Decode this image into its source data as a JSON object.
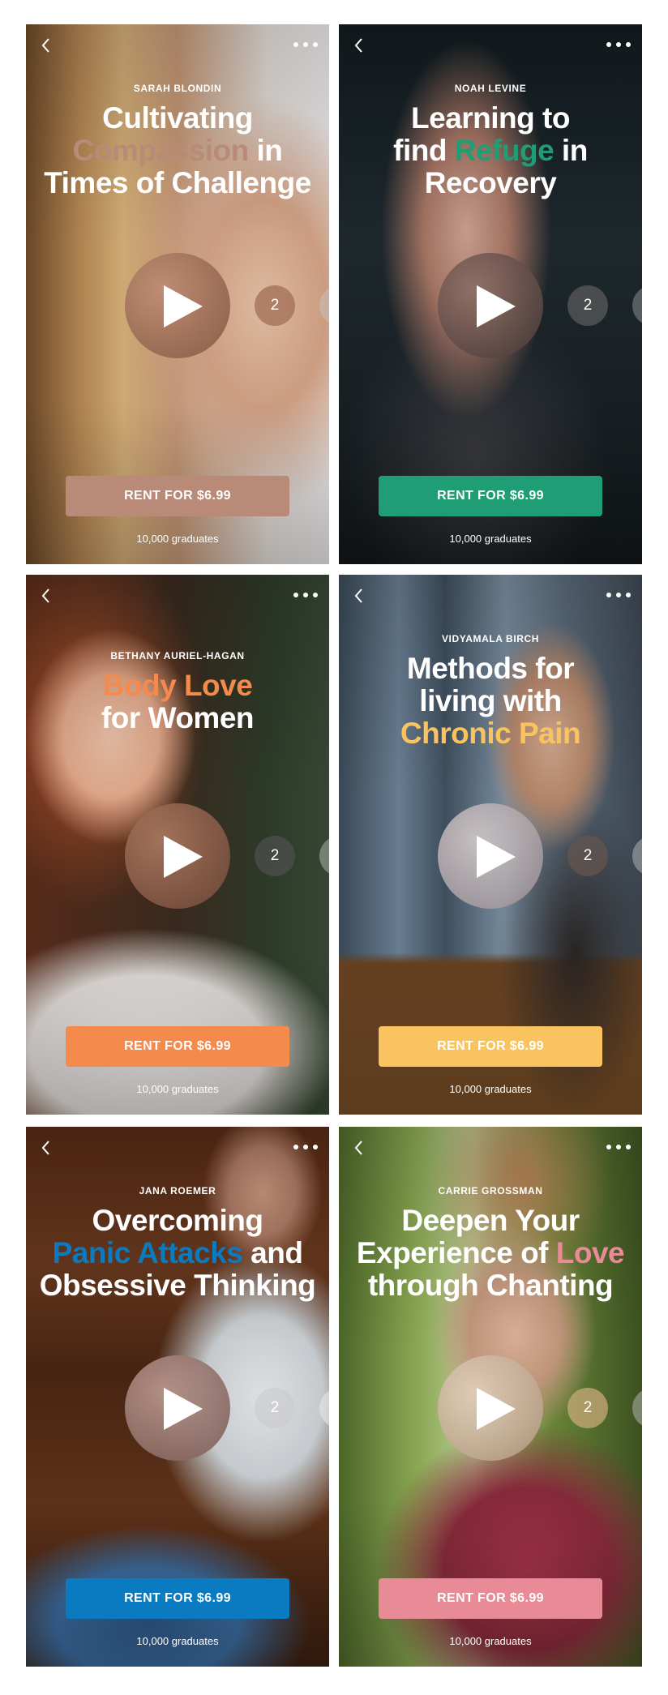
{
  "cards": [
    {
      "author": "SARAH BLONDIN",
      "title": [
        [
          "Cultivating",
          ""
        ],
        [
          "Compassion",
          " in"
        ],
        [
          "Times of Challenge",
          ""
        ]
      ],
      "title_lines": [
        {
          "pre": "Cultivating",
          "hl": "",
          "post": ""
        },
        {
          "pre": "",
          "hl": "Compassion",
          "post": " in"
        },
        {
          "pre": "Times of Challenge",
          "hl": "",
          "post": ""
        }
      ],
      "accent": "#b98a77",
      "badge": "2",
      "cta": "RENT FOR $6.99",
      "graduates": "10,000 graduates"
    },
    {
      "author": "NOAH LEVINE",
      "title_lines": [
        {
          "pre": "Learning to",
          "hl": "",
          "post": ""
        },
        {
          "pre": "find ",
          "hl": "Refuge",
          "post": " in"
        },
        {
          "pre": "Recovery",
          "hl": "",
          "post": ""
        }
      ],
      "accent": "#1f9e75",
      "badge": "2",
      "cta": "RENT FOR $6.99",
      "graduates": "10,000 graduates"
    },
    {
      "author": "BETHANY AURIEL-HAGAN",
      "title_lines": [
        {
          "pre": "",
          "hl": "Body Love",
          "post": ""
        },
        {
          "pre": "for Women",
          "hl": "",
          "post": ""
        }
      ],
      "accent": "#f48a4c",
      "badge": "2",
      "cta": "RENT FOR $6.99",
      "graduates": "10,000 graduates"
    },
    {
      "author": "VIDYAMALA BIRCH",
      "title_lines": [
        {
          "pre": "Methods for",
          "hl": "",
          "post": ""
        },
        {
          "pre": "living with",
          "hl": "",
          "post": ""
        },
        {
          "pre": "",
          "hl": "Chronic Pain",
          "post": ""
        }
      ],
      "accent": "#f9c460",
      "badge": "2",
      "cta": "RENT FOR $6.99",
      "graduates": "10,000 graduates"
    },
    {
      "author": "JANA ROEMER",
      "title_lines": [
        {
          "pre": "Overcoming",
          "hl": "",
          "post": ""
        },
        {
          "pre": "",
          "hl": "Panic Attacks",
          "post": " and"
        },
        {
          "pre": "Obsessive Thinking",
          "hl": "",
          "post": ""
        }
      ],
      "accent": "#0a7bc1",
      "badge": "2",
      "cta": "RENT FOR $6.99",
      "graduates": "10,000 graduates"
    },
    {
      "author": "CARRIE GROSSMAN",
      "title_lines": [
        {
          "pre": "Deepen Your",
          "hl": "",
          "post": ""
        },
        {
          "pre": "Experience of ",
          "hl": "Love",
          "post": ""
        },
        {
          "pre": "through Chanting",
          "hl": "",
          "post": ""
        }
      ],
      "accent": "#e88b96",
      "badge": "2",
      "cta": "RENT FOR $6.99",
      "graduates": "10,000 graduates"
    }
  ]
}
